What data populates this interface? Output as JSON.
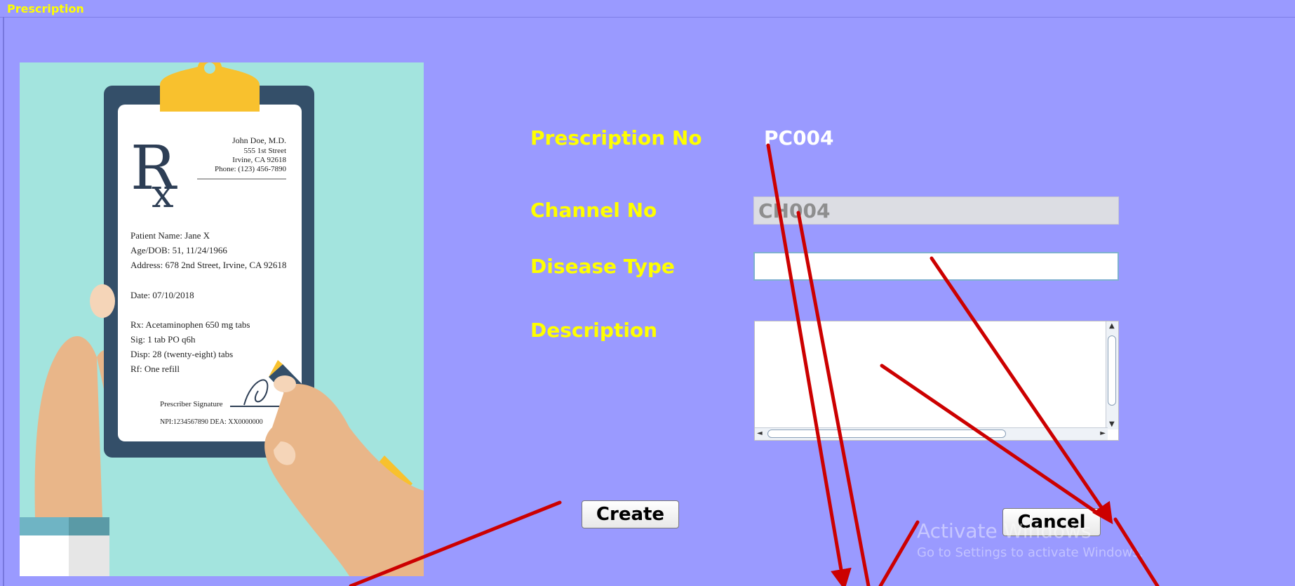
{
  "window": {
    "title": "Prescription"
  },
  "form": {
    "prescription_no_label": "Prescription No",
    "prescription_no_value": "PC004",
    "channel_no_label": "Channel No",
    "channel_no_value": "CH004",
    "disease_type_label": "Disease Type",
    "disease_type_value": "",
    "description_label": "Description",
    "description_value": ""
  },
  "buttons": {
    "create": "Create",
    "cancel": "Cancel"
  },
  "prescription_pad": {
    "doctor": "John Doe, M.D.",
    "street": "555 1st Street",
    "city": "Irvine, CA 92618",
    "phone": "Phone: (123) 456-7890",
    "patient": "Patient Name: Jane X",
    "age": "Age/DOB: 51, 11/24/1966",
    "address": "Address: 678 2nd Street, Irvine, CA 92618",
    "date": "Date: 07/10/2018",
    "rx": "Rx: Acetaminophen 650 mg tabs",
    "sig": "Sig: 1 tab PO q6h",
    "disp": "Disp: 28 (twenty-eight) tabs",
    "rf": "Rf: One refill",
    "signature_label": "Prescriber Signature",
    "npi": "NPI:1234567890     DEA: XX0000000"
  },
  "watermark": {
    "line1": "Activate Windows",
    "line2": "Go to Settings to activate Windows."
  },
  "colors": {
    "background": "#9a9aff",
    "label": "#ffff00",
    "annotation_arrow": "#cc0000"
  }
}
